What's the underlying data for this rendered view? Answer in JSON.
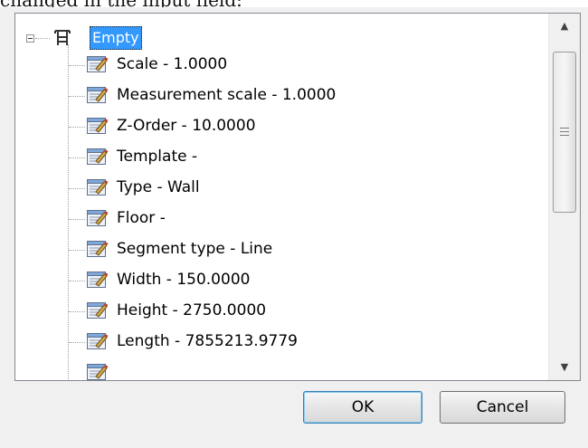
{
  "intro_text": "changed in the input field:",
  "tree": {
    "root_label": "Empty",
    "items": [
      "Scale - 1.0000",
      "Measurement scale - 1.0000",
      "Z-Order - 10.0000",
      "Template -",
      "Type - Wall",
      "Floor -",
      "Segment type - Line",
      "Width - 150.0000",
      "Height - 2750.0000",
      "Length - 7855213.9779"
    ]
  },
  "buttons": {
    "ok": "OK",
    "cancel": "Cancel"
  },
  "scrollbar": {
    "up_icon": "up-arrow-icon",
    "down_icon": "down-arrow-icon",
    "position": 0
  },
  "colors": {
    "selection": "#3399ff",
    "dialog_bg": "#f0f0f0",
    "border": "#828790"
  }
}
